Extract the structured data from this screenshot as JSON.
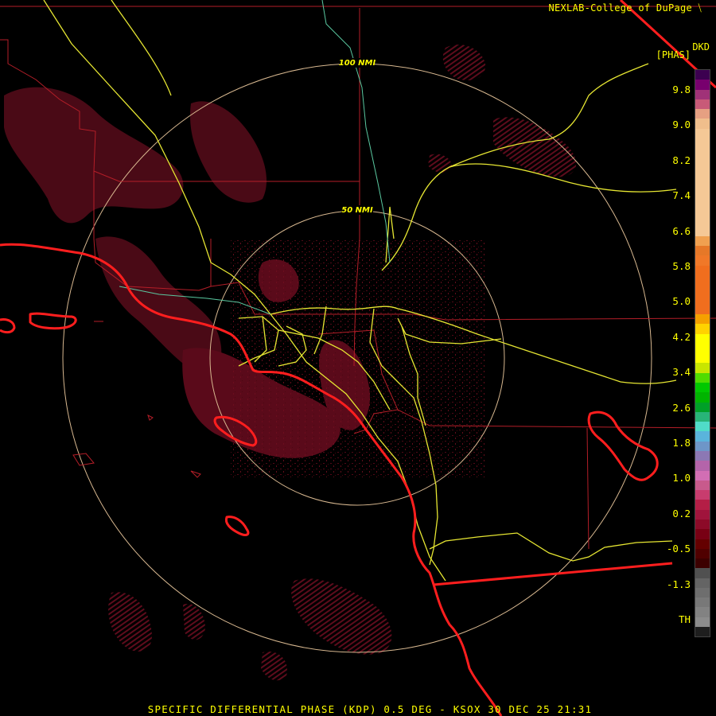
{
  "header": {
    "credit": "NEXLAB-College of DuPage",
    "credit_mark": "⧹",
    "product": "DKD",
    "unit": "[PHAS]"
  },
  "rings": {
    "inner_label": "50 NMI",
    "outer_label": "100 NMI"
  },
  "legend": {
    "ticks": [
      "9.8",
      "9.0",
      "8.2",
      "7.4",
      "6.6",
      "5.8",
      "5.0",
      "4.2",
      "3.4",
      "2.6",
      "1.8",
      "1.0",
      "0.2",
      "-0.5",
      "-1.3",
      "TH"
    ],
    "colors": [
      "#3c0050",
      "#78006e",
      "#a03278",
      "#c85a78",
      "#e6a082",
      "#f0be8c",
      "#f5c896",
      "#f5c896",
      "#f5c896",
      "#f5c896",
      "#f5c896",
      "#f5c896",
      "#f5c896",
      "#f5c896",
      "#f5c896",
      "#f5c896",
      "#f5c896",
      "#f0a050",
      "#e67828",
      "#f07828",
      "#f06e1e",
      "#f06e1e",
      "#f06e1e",
      "#f06e1e",
      "#f06e1e",
      "#f5a000",
      "#ffd200",
      "#ffff00",
      "#ffff00",
      "#ffff00",
      "#c8e600",
      "#50dc00",
      "#00c800",
      "#00b400",
      "#00a028",
      "#28b478",
      "#50dcc8",
      "#5ab4dc",
      "#6e96c8",
      "#8c78b4",
      "#b464aa",
      "#d26eb4",
      "#c85a8c",
      "#c83c6e",
      "#b41e46",
      "#a0143c",
      "#8c0a28",
      "#780014",
      "#640000",
      "#500000",
      "#3c0000",
      "#505050",
      "#646464",
      "#6e6e6e",
      "#787878",
      "#828282",
      "#8c8c8c",
      "#1e1e1e"
    ]
  },
  "footer": {
    "caption": "SPECIFIC DIFFERENTIAL PHASE (KDP) 0.5 DEG - KSOX 30 DEC 25 21:31"
  }
}
